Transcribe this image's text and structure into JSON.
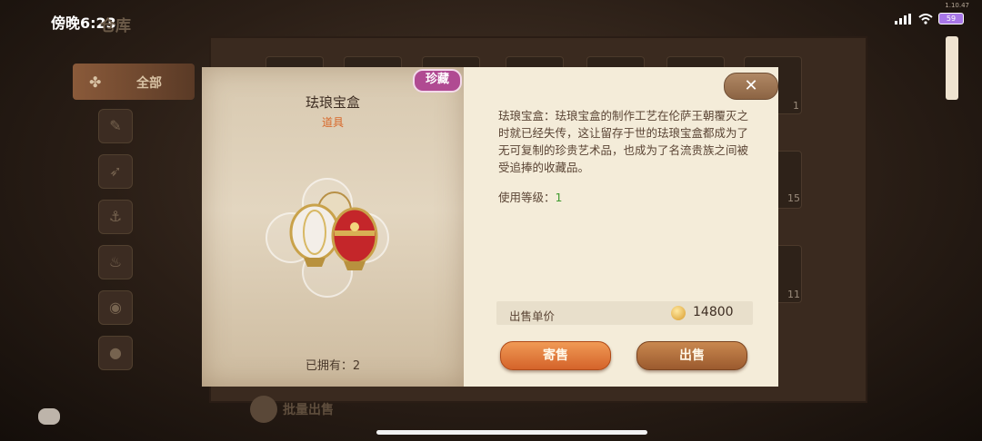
{
  "status_bar": {
    "time": "傍晚6:23",
    "version": "1.10.47",
    "battery": "59"
  },
  "background": {
    "title": "仓库",
    "sidebar_all": "全部",
    "bulk_sell": "批量出售",
    "slot_counts": [
      "1",
      "15",
      "11"
    ]
  },
  "item": {
    "name": "珐琅宝盒",
    "type": "道具",
    "rarity": "珍藏",
    "owned_label": "已拥有：2",
    "description": "珐琅宝盒：珐琅宝盒的制作工艺在伦萨王朝覆灭之时就已经失传，这让留存于世的珐琅宝盒都成为了无可复制的珍贵艺术品，也成为了名流贵族之间被受追捧的收藏品。",
    "level_label": "使用等级：",
    "level_value": "1",
    "price_label": "出售单价",
    "price_value": "14800"
  },
  "buttons": {
    "consign": "寄售",
    "sell": "出售",
    "close": "✕"
  },
  "icons": [
    "close-icon",
    "coin-icon",
    "chat-icon",
    "wifi-icon",
    "signal-icon",
    "battery-icon"
  ]
}
